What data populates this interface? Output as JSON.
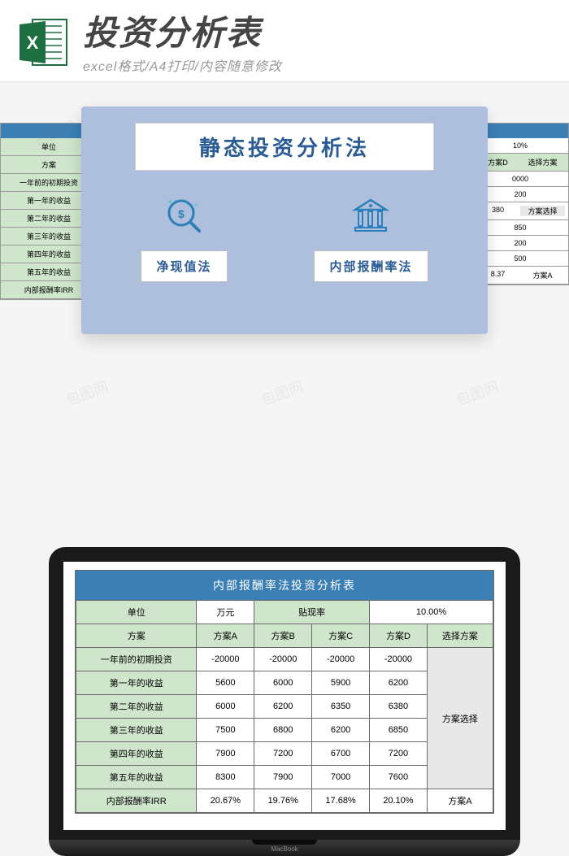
{
  "header": {
    "title": "投资分析表",
    "subtitle": "excel格式/A4打印/内容随意修改"
  },
  "card": {
    "title": "静态投资分析法",
    "method1": "净现值法",
    "method2": "内部报酬率法"
  },
  "bg_left": {
    "rows": [
      "单位",
      "方案",
      "一年前的初期投资",
      "第一年的收益",
      "第二年的收益",
      "第三年的收益",
      "第四年的收益",
      "第五年的收益",
      "内部报酬率IRR"
    ]
  },
  "bg_right": {
    "rate": "10%",
    "col_d": "方案D",
    "select_label": "选择方案",
    "vals": [
      "0000",
      "200",
      "380",
      "850",
      "200",
      "500",
      "8.37"
    ],
    "select_btn": "方案选择",
    "result": "方案A"
  },
  "laptop_label": "MacBook",
  "chart_data": {
    "type": "table",
    "title": "内部报酬率法投资分析表",
    "header_row1": {
      "unit_label": "单位",
      "unit_value": "万元",
      "rate_label": "贴现率",
      "rate_value": "10.00%"
    },
    "header_row2": [
      "方案",
      "方案A",
      "方案B",
      "方案C",
      "方案D",
      "选择方案"
    ],
    "rows": [
      {
        "label": "一年前的初期投资",
        "a": "-20000",
        "b": "-20000",
        "c": "-20000",
        "d": "-20000"
      },
      {
        "label": "第一年的收益",
        "a": "5600",
        "b": "6000",
        "c": "5900",
        "d": "6200"
      },
      {
        "label": "第二年的收益",
        "a": "6000",
        "b": "6200",
        "c": "6350",
        "d": "6380"
      },
      {
        "label": "第三年的收益",
        "a": "7500",
        "b": "6800",
        "c": "6200",
        "d": "6850"
      },
      {
        "label": "第四年的收益",
        "a": "7900",
        "b": "7200",
        "c": "6700",
        "d": "7200"
      },
      {
        "label": "第五年的收益",
        "a": "8300",
        "b": "7900",
        "c": "7000",
        "d": "7600"
      },
      {
        "label": "内部报酬率IRR",
        "a": "20.67%",
        "b": "19.76%",
        "c": "17.68%",
        "d": "20.10%"
      }
    ],
    "select_button": "方案选择",
    "result": "方案A"
  }
}
